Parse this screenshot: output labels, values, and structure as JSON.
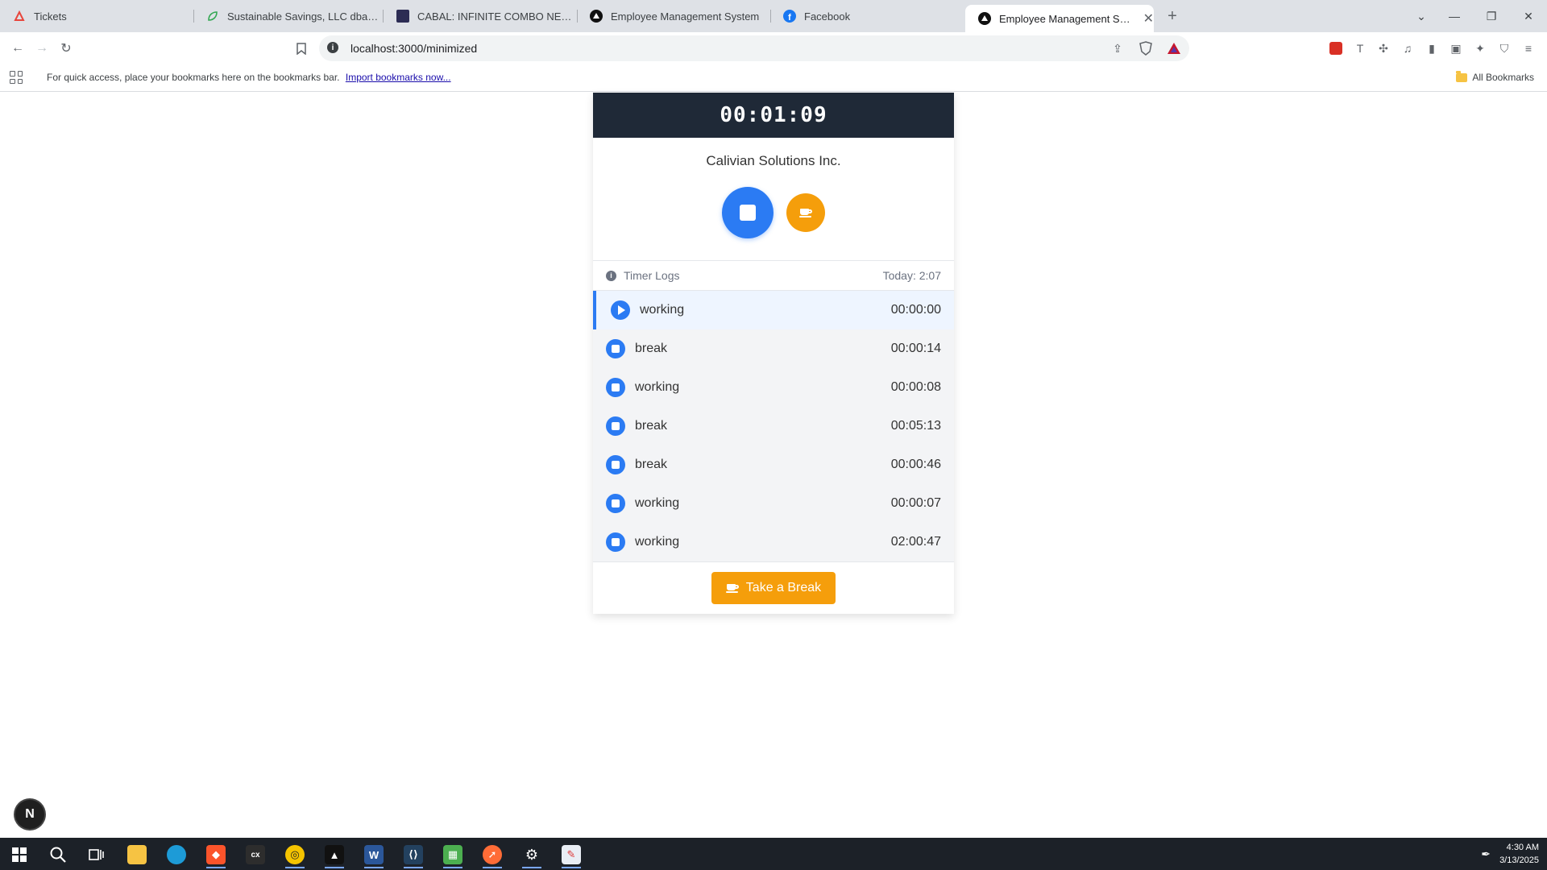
{
  "browser": {
    "tabs": [
      {
        "title": "Tickets",
        "icon": "ticket-icon",
        "color": "#e8453c"
      },
      {
        "title": "Sustainable Savings, LLC dba Sustain",
        "icon": "leaf-icon",
        "color": "#34a853"
      },
      {
        "title": "CABAL: INFINITE COMBO NEWS",
        "icon": "cabal-icon",
        "color": "#2c2c54"
      },
      {
        "title": "Employee Management System",
        "icon": "app-triangle-icon",
        "color": "#111111"
      },
      {
        "title": "Facebook",
        "icon": "facebook-icon",
        "color": "#1877f2"
      },
      {
        "title": "Employee Management System",
        "icon": "app-triangle-icon",
        "color": "#111111"
      }
    ],
    "new_tab": "+",
    "url": "localhost:3000/minimized",
    "bookmarks_bar": {
      "hint": "For quick access, place your bookmarks here on the bookmarks bar.",
      "import_link": "Import bookmarks now...",
      "all_bookmarks": "All Bookmarks"
    }
  },
  "app": {
    "timer": "00:01:09",
    "company": "Calivian Solutions Inc.",
    "logs_title": "Timer Logs",
    "logs_today": "Today: 2:07",
    "logs": [
      {
        "type": "working",
        "duration": "00:00:00",
        "active": true
      },
      {
        "type": "break",
        "duration": "00:00:14",
        "active": false
      },
      {
        "type": "working",
        "duration": "00:00:08",
        "active": false
      },
      {
        "type": "break",
        "duration": "00:05:13",
        "active": false
      },
      {
        "type": "break",
        "duration": "00:00:46",
        "active": false
      },
      {
        "type": "working",
        "duration": "00:00:07",
        "active": false
      },
      {
        "type": "working",
        "duration": "02:00:47",
        "active": false
      }
    ],
    "take_break_label": "Take a Break",
    "colors": {
      "primary": "#2b7bf3",
      "accent": "#f59e0b",
      "header": "#1f2937"
    }
  },
  "dev_badge": "N",
  "taskbar": {
    "time": "4:30 AM",
    "date": "3/13/2025"
  }
}
